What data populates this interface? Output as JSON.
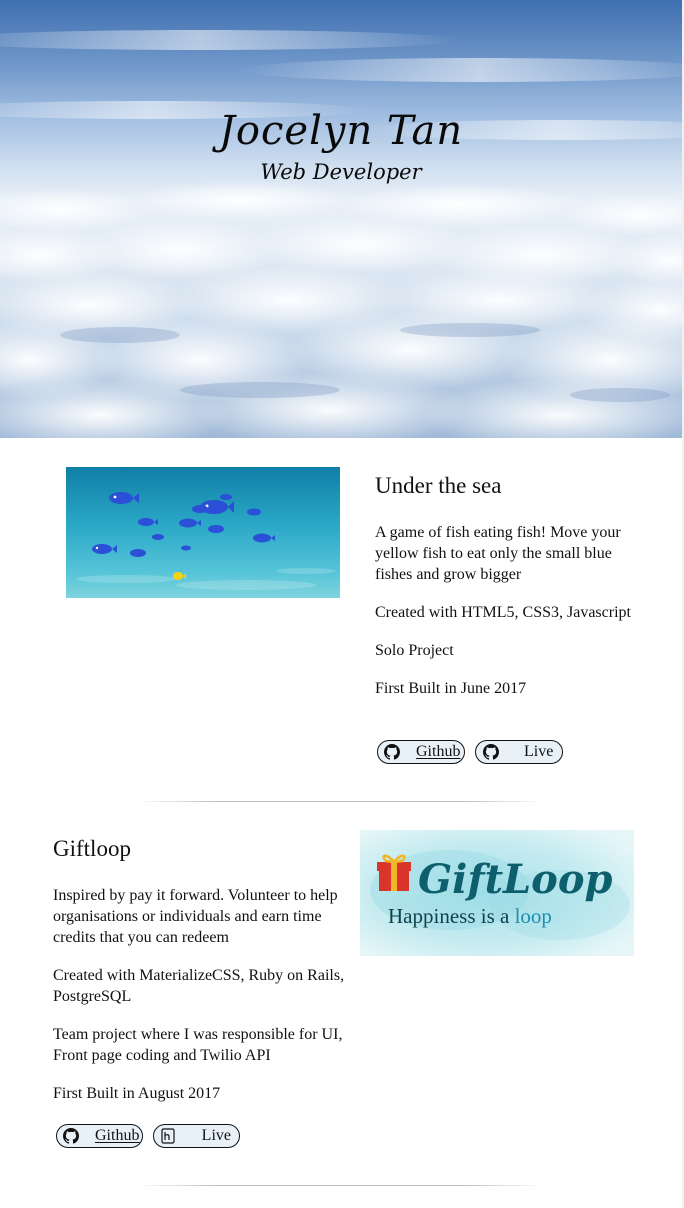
{
  "hero": {
    "name": "Jocelyn Tan",
    "role": "Web Developer"
  },
  "projects": [
    {
      "title": "Under the sea",
      "description": "A game of fish eating fish! Move your yellow fish to eat only the small blue fishes and grow bigger",
      "tech": "Created with HTML5, CSS3, Javascript",
      "team": "Solo Project",
      "built": "First Built in June 2017",
      "buttons": [
        {
          "label": "Github",
          "icon": "github-icon"
        },
        {
          "label": "Live",
          "icon": "github-icon"
        }
      ]
    },
    {
      "title": "Giftloop",
      "description": "Inspired by pay it forward. Volunteer to help organisations or individuals and earn time credits that you can redeem",
      "tech": "Created with MaterializeCSS, Ruby on Rails, PostgreSQL",
      "team": "Team project where I was responsible for UI, Front page coding and Twilio API",
      "built": "First Built in August 2017",
      "buttons": [
        {
          "label": "Github",
          "icon": "github-icon"
        },
        {
          "label": "Live",
          "icon": "heroku-icon"
        }
      ],
      "logo": {
        "name": "GiftLoop",
        "tagline_prefix": "Happiness is a ",
        "tagline_accent": "loop"
      }
    }
  ],
  "colors": {
    "button_bg": "#e9f1f8",
    "sea": "#23a6c4",
    "giftloop_teal": "#0e5f6e",
    "gift_red": "#d9352a",
    "gift_yellow": "#f2b526"
  }
}
